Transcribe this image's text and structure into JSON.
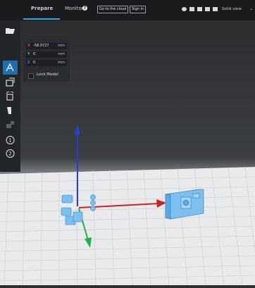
{
  "topbar": {
    "tab_prepare": "Prepare",
    "tab_monitor": "Monitor",
    "help_icon": "question-icon",
    "btn_cloud": "Go to the cloud",
    "btn_signin": "Sign In",
    "view_mode": "Solid view"
  },
  "sidebar": {
    "tools": [
      "open-file-icon",
      "move-icon",
      "scale-icon",
      "rotate-icon",
      "mirror-icon",
      "support-icon",
      "extruder-1-icon",
      "extruder-2-icon"
    ],
    "extruder_1": "1",
    "extruder_2": "2"
  },
  "move_panel": {
    "x_label": "X",
    "x_value": "-58.0727",
    "x_unit": "mm",
    "y_label": "Y",
    "y_value": "0",
    "y_unit": "mm",
    "z_label": "Z",
    "z_value": "0",
    "z_unit": "mm",
    "lock_label": "Lock Model"
  },
  "colors": {
    "accent": "#3aa1e6",
    "model": "#7cc0f2",
    "x_axis": "#cc2222",
    "y_axis": "#22b050",
    "z_axis": "#2a3fd0"
  }
}
